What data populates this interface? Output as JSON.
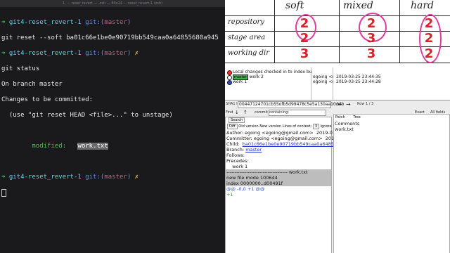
{
  "terminal": {
    "title": "1. ... reset_revert — -zsh — 80x24 ... reset_revert-1 (zsh)",
    "prompt_arrow": "➜",
    "prompt_dir": "git4-reset_revert-1",
    "prompt_git": "git:(",
    "prompt_branch": "master",
    "prompt_close": ")",
    "prompt_x": "✗",
    "lines": [
      "git reset --soft ba01c66e1be0e90719bb549caa0a64855680a945",
      "git status",
      "On branch master",
      "Changes to be committed:",
      "  (use \"git reset HEAD <file>...\" to unstage)",
      "modified:",
      "work.txt"
    ]
  },
  "table": {
    "headers": [
      "soft",
      "mixed",
      "hard"
    ],
    "rows": [
      {
        "label": "repository",
        "values": [
          "2",
          "2",
          "2"
        ]
      },
      {
        "label": "stage area",
        "values": [
          "2",
          "3",
          "2"
        ]
      },
      {
        "label": "working dir",
        "values": [
          "3",
          "3",
          "2"
        ]
      }
    ]
  },
  "gitk": {
    "commits": [
      {
        "msg": "Local changes checked in to index but not",
        "author": "",
        "date": ""
      },
      {
        "branch": "master",
        "msg": "work 2",
        "author": "egoing <e",
        "date": "2019-03-25 23:44:35"
      },
      {
        "msg": "work 1",
        "author": "egoing <e",
        "date": "2019-03-25 23:44:28"
      }
    ],
    "sha_label": "SHA1 ID:",
    "sha_value": "00447124701cb55ofb5d99478c5e5a130aa10ddb",
    "row_label": "Row",
    "row_value": "1 / 3",
    "find_label": "Find",
    "find_mode": "commit",
    "find_type": "containing:",
    "exact_label": "Exact",
    "all_fields_label": "All fields",
    "search_label": "Search",
    "diff_label": "Diff",
    "old_version_label": "Old version",
    "new_version_label": "New version",
    "lines_of_context_label": "Lines of context:",
    "lines_of_context_value": "3",
    "ignore_label": "Ignore",
    "patch_label": "Patch",
    "tree_label": "Tree",
    "details": [
      "Author: egoing <egoing@gmail.com>  2019-03-",
      "Committer: egoing <egoing@gmail.com>  2019-0",
      "Branch: ",
      "Follows:",
      "Precedes:",
      "",
      "    work 1",
      ""
    ],
    "child_label": "Child:  ",
    "child_value": "ba01c66e1be0e90719bb549caa0a64855680",
    "branch_link": "master",
    "diff_header": "------------------------------------- work.txt",
    "diff_mode": "new file mode 100644",
    "diff_index": "index 0000000..d00491f",
    "diff_hunk": "@@ -0,0 +1 @@",
    "diff_add": "+1",
    "files": [
      "Comments",
      "work.txt"
    ]
  },
  "colors": {
    "arrow": "#39d353",
    "branch": "#e0527a",
    "numbers": "#d8222b",
    "circles": "#e23a9a"
  }
}
